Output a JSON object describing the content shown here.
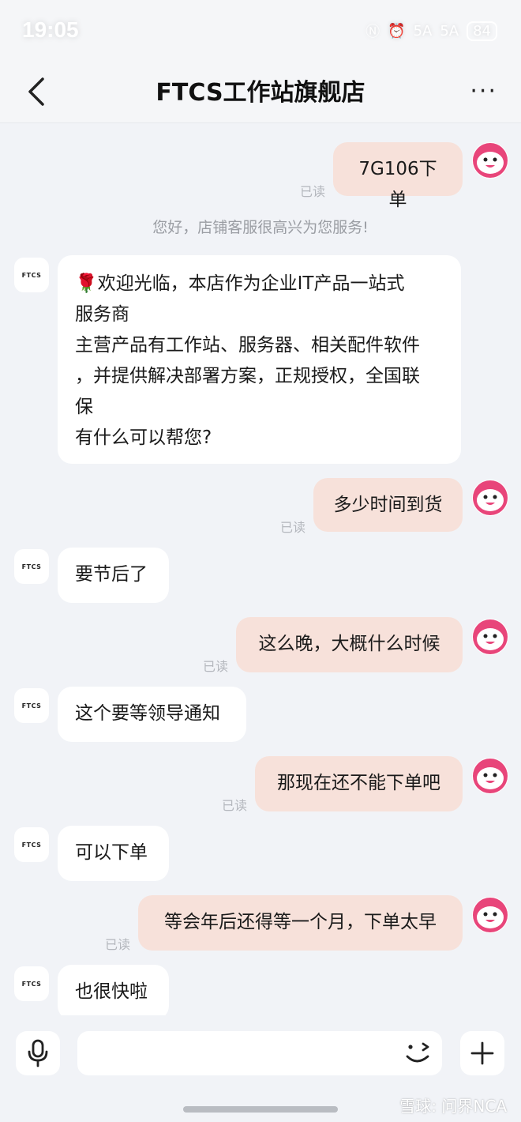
{
  "status": {
    "time": "19:05",
    "signal1": "5A",
    "signal2": "5A",
    "battery": "84"
  },
  "header": {
    "title": "FTCS工作站旗舰店",
    "more": "···"
  },
  "messages": {
    "m1": "7G106下单",
    "system": "您好，店铺客服很高兴为您服务!",
    "m2_icon": "🌹",
    "m2": [
      "欢迎光临，本店作为企业IT产品一站式",
      "服务商",
      "主营产品有工作站、服务器、相关配件软件",
      "，并提供解决部署方案，正规授权，全国联",
      "保",
      "有什么可以帮您?"
    ],
    "m3": "多少时间到货",
    "m4": "要节后了",
    "m5": "这么晚，大概什么时候",
    "m6": "这个要等领导通知",
    "m7": "那现在还不能下单吧",
    "m8": "可以下单",
    "m9": "等会年后还得等一个月，下单太早",
    "m10": "也很快啦"
  },
  "read_label": "已读",
  "shop_avatar_text": "FTCS",
  "input": {
    "placeholder": ""
  },
  "watermark": "雪球: 问界NCA",
  "colors": {
    "my_bubble": "#f7e1da",
    "their_bubble": "#ffffff",
    "background": "#f1f3f7",
    "avatar_pink": "#e8457a"
  },
  "icons": {
    "back": "chevron-left-icon",
    "more": "more-dots-icon",
    "mic": "microphone-icon",
    "emoji": "wink-emoji-icon",
    "plus": "plus-icon"
  }
}
